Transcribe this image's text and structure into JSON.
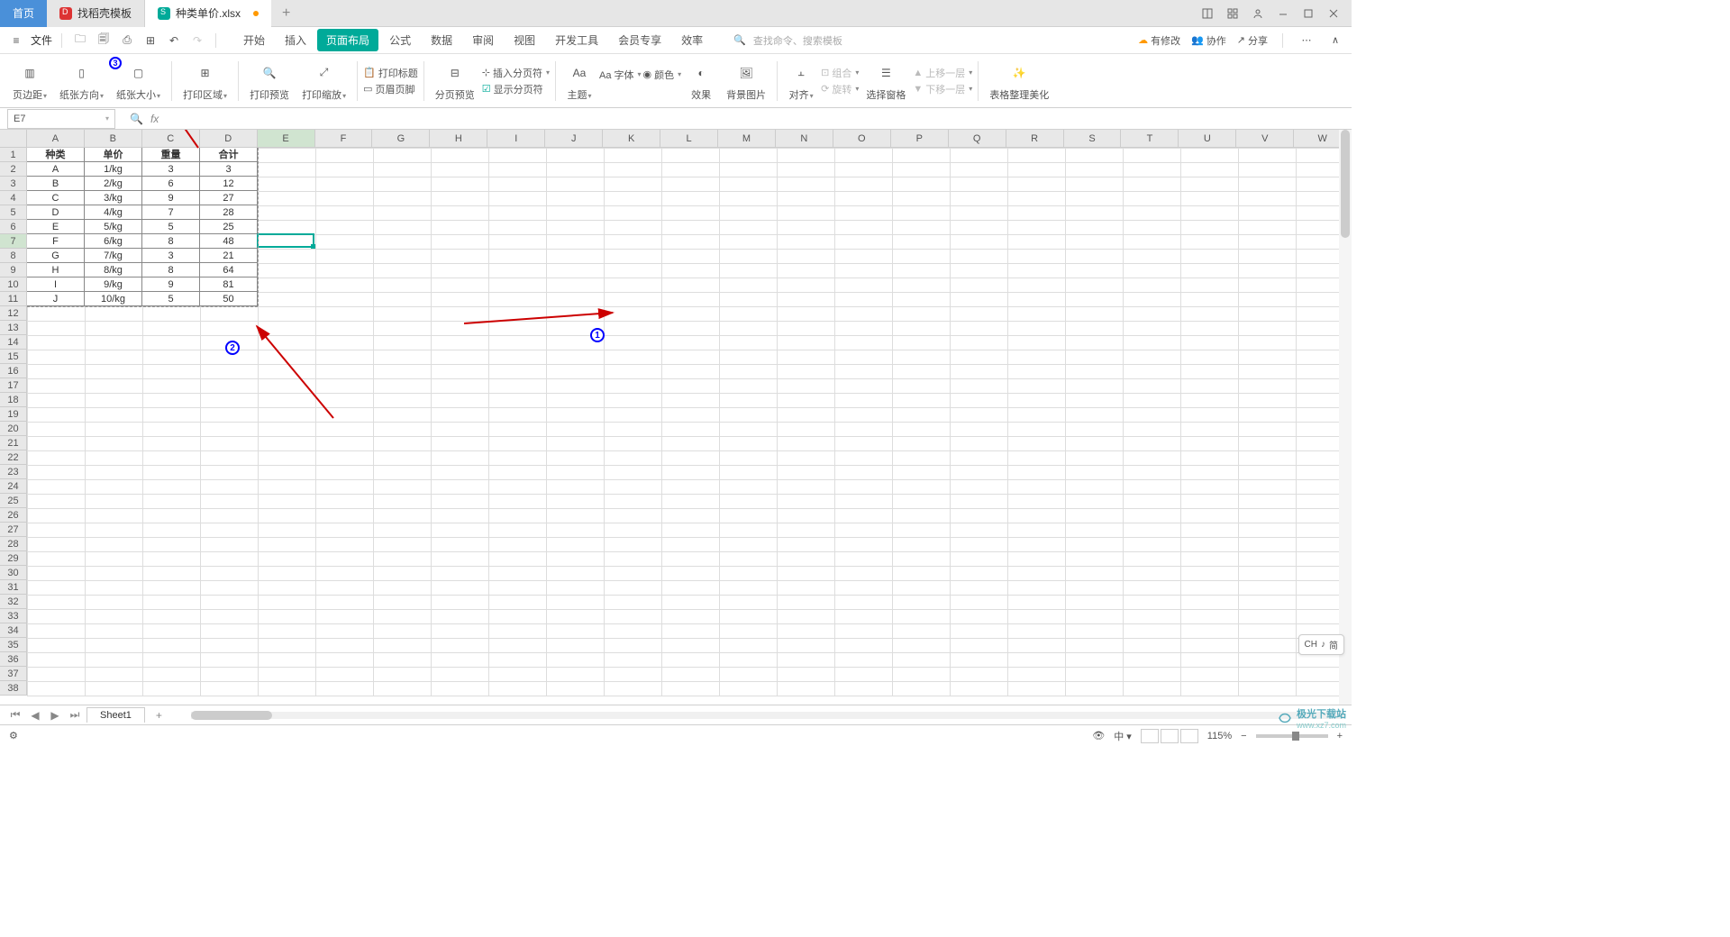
{
  "tabs": {
    "home": "首页",
    "doc1": "找稻壳模板",
    "doc2": "种类单价.xlsx"
  },
  "menu": {
    "file": "文件",
    "items": [
      "开始",
      "插入",
      "页面布局",
      "公式",
      "数据",
      "审阅",
      "视图",
      "开发工具",
      "会员专享",
      "效率"
    ],
    "search_hint": "查找命令、搜索模板",
    "search_icon": "Q",
    "right": {
      "changes": "有修改",
      "collab": "协作",
      "share": "分享"
    }
  },
  "ribbon": {
    "margin": "页边距",
    "orient": "纸张方向",
    "size": "纸张大小",
    "printarea": "打印区域",
    "preview": "打印预览",
    "scaling": "打印缩放",
    "titles": "打印标题",
    "hf": "页眉页脚",
    "pagebreak": "分页预览",
    "insertbreak": "插入分页符",
    "showbreak": "显示分页符",
    "theme": "主题",
    "font": "Aa 字体",
    "color": "颜色",
    "effect": "效果",
    "bgimg": "背景图片",
    "align": "对齐",
    "group": "组合",
    "rotate": "旋转",
    "selpane": "选择窗格",
    "up1": "上移一层",
    "down1": "下移一层",
    "beautify": "表格整理美化"
  },
  "namebox": "E7",
  "fx": "fx",
  "columns": [
    "A",
    "B",
    "C",
    "D",
    "E",
    "F",
    "G",
    "H",
    "I",
    "J",
    "K",
    "L",
    "M",
    "N",
    "O",
    "P",
    "Q",
    "R",
    "S",
    "T",
    "U",
    "V",
    "W"
  ],
  "table": {
    "headers": [
      "种类",
      "单价",
      "重量",
      "合计"
    ],
    "rows": [
      [
        "A",
        "1/kg",
        "3",
        "3"
      ],
      [
        "B",
        "2/kg",
        "6",
        "12"
      ],
      [
        "C",
        "3/kg",
        "9",
        "27"
      ],
      [
        "D",
        "4/kg",
        "7",
        "28"
      ],
      [
        "E",
        "5/kg",
        "5",
        "25"
      ],
      [
        "F",
        "6/kg",
        "8",
        "48"
      ],
      [
        "G",
        "7/kg",
        "3",
        "21"
      ],
      [
        "H",
        "8/kg",
        "8",
        "64"
      ],
      [
        "I",
        "9/kg",
        "9",
        "81"
      ],
      [
        "J",
        "10/kg",
        "5",
        "50"
      ]
    ]
  },
  "selected": {
    "col": 4,
    "row": 6
  },
  "sheet": {
    "name": "Sheet1"
  },
  "status": {
    "zoom": "115%"
  },
  "ime": {
    "lang": "CH",
    "mode": "简"
  },
  "watermark": {
    "name": "极光下载站",
    "url": "www.xz7.com"
  },
  "annotations": {
    "n1": "1",
    "n2": "2",
    "n3": "3"
  }
}
